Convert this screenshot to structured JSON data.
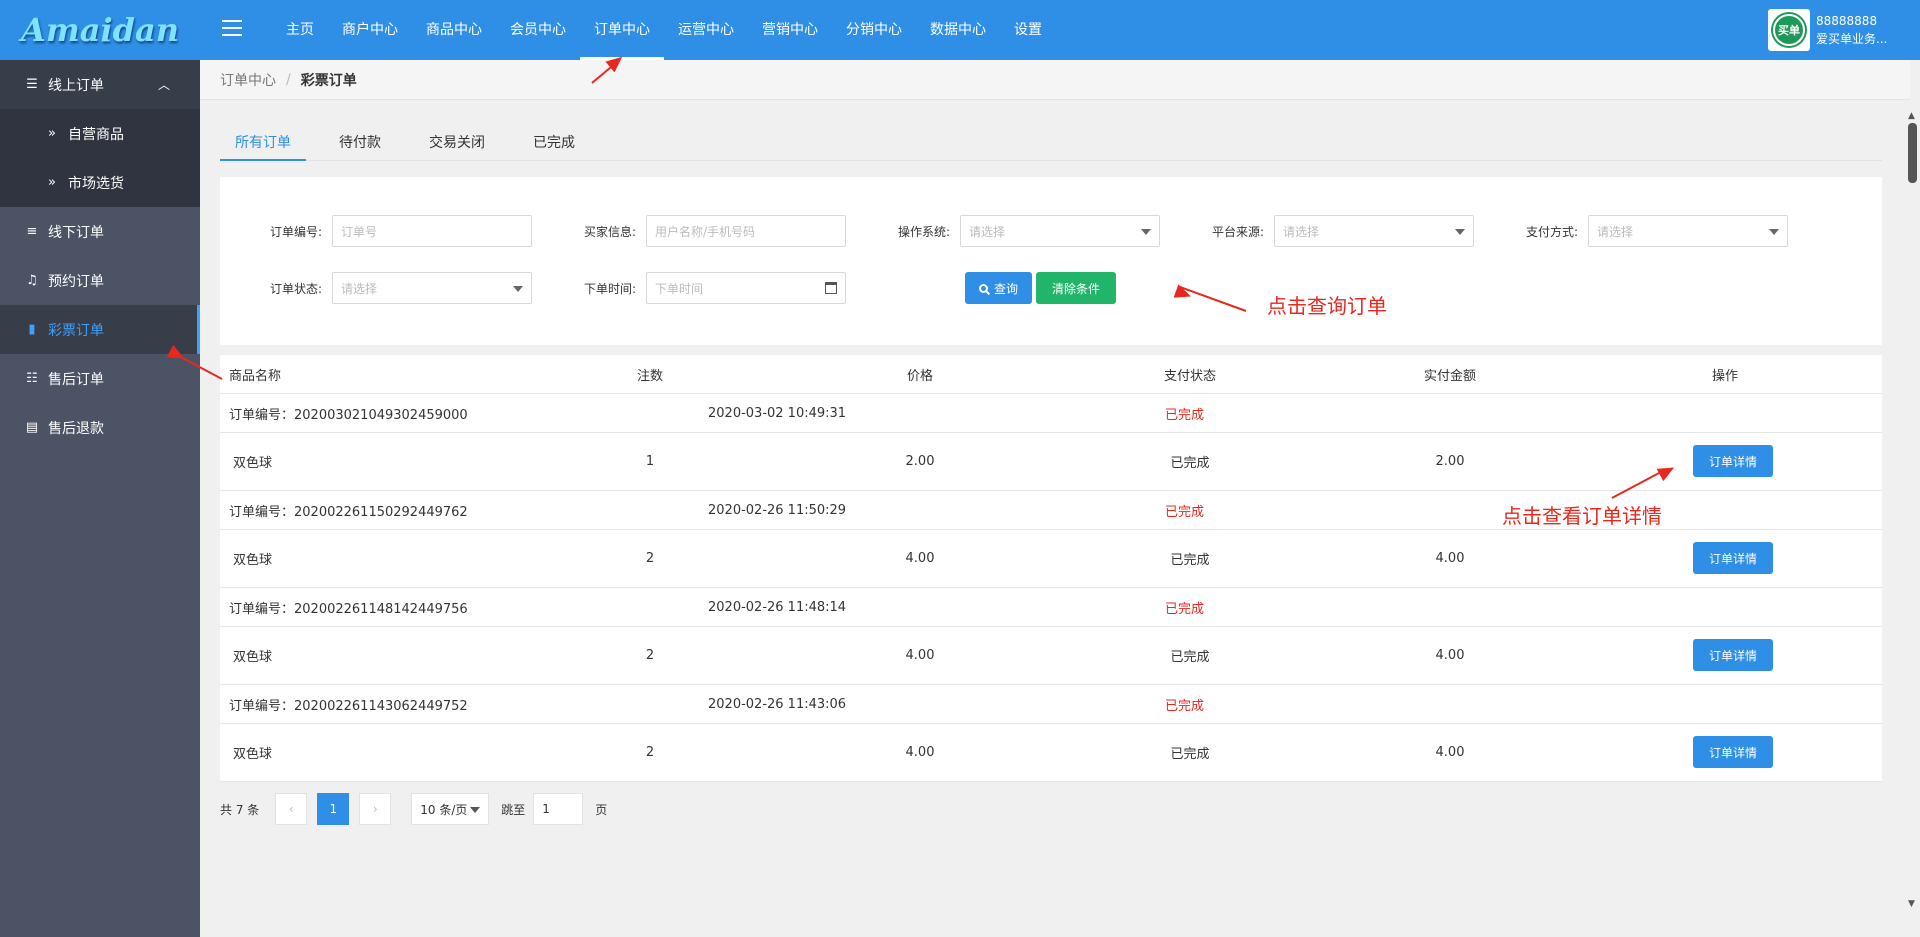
{
  "logo": "Amaidan",
  "topnav": [
    "主页",
    "商户中心",
    "商品中心",
    "会员中心",
    "订单中心",
    "运营中心",
    "营销中心",
    "分销中心",
    "数据中心",
    "设置"
  ],
  "topnav_active": 4,
  "user": {
    "id": "88888888",
    "name": "爱买单业务...",
    "avatar_text": "买单"
  },
  "sidebar": {
    "online": "线上订单",
    "self_goods": "自营商品",
    "market": "市场选货",
    "offline": "线下订单",
    "booking": "预约订单",
    "lottery": "彩票订单",
    "aftersale": "售后订单",
    "refund": "售后退款"
  },
  "breadcrumb": {
    "parent": "订单中心",
    "current": "彩票订单"
  },
  "tabs": [
    "所有订单",
    "待付款",
    "交易关闭",
    "已完成"
  ],
  "filters": {
    "order_no": {
      "label": "订单编号:",
      "placeholder": "订单号"
    },
    "buyer": {
      "label": "买家信息:",
      "placeholder": "用户名称/手机号码"
    },
    "os": {
      "label": "操作系统:",
      "placeholder": "请选择"
    },
    "platform": {
      "label": "平台来源:",
      "placeholder": "请选择"
    },
    "pay": {
      "label": "支付方式:",
      "placeholder": "请选择"
    },
    "status": {
      "label": "订单状态:",
      "placeholder": "请选择"
    },
    "time": {
      "label": "下单时间:",
      "placeholder": "下单时间"
    },
    "query_btn": "查询",
    "clear_btn": "清除条件"
  },
  "annotations": {
    "query_note": "点击查询订单",
    "detail_note": "点击查看订单详情"
  },
  "table": {
    "headers": [
      "商品名称",
      "注数",
      "价格",
      "支付状态",
      "实付金额",
      "操作"
    ],
    "detail_label": "订单详情",
    "orders": [
      {
        "no": "订单编号：20200302104930245900​0",
        "time": "2020-03-02 10:49:31",
        "status": "已完成",
        "item": "双色球",
        "count": "1",
        "price": "2.00",
        "pay_status": "已完成",
        "paid": "2.00"
      },
      {
        "no": "订单编号：2020022611502924497​62",
        "time": "2020-02-26 11:50:29",
        "status": "已完成",
        "item": "双色球",
        "count": "2",
        "price": "4.00",
        "pay_status": "已完成",
        "paid": "4.00"
      },
      {
        "no": "订单编号：2020022611481424497​56",
        "time": "2020-02-26 11:48:14",
        "status": "已完成",
        "item": "双色球",
        "count": "2",
        "price": "4.00",
        "pay_status": "已完成",
        "paid": "4.00"
      },
      {
        "no": "订单编号：2020022611430624497​52",
        "time": "2020-02-26 11:43:06",
        "status": "已完成",
        "item": "双色球",
        "count": "2",
        "price": "4.00",
        "pay_status": "已完成",
        "paid": "4.00"
      }
    ]
  },
  "pager": {
    "total": "共 7 条",
    "current": "1",
    "size": "10 条/页",
    "jump": "跳至",
    "jump_value": "1",
    "unit": "页"
  }
}
